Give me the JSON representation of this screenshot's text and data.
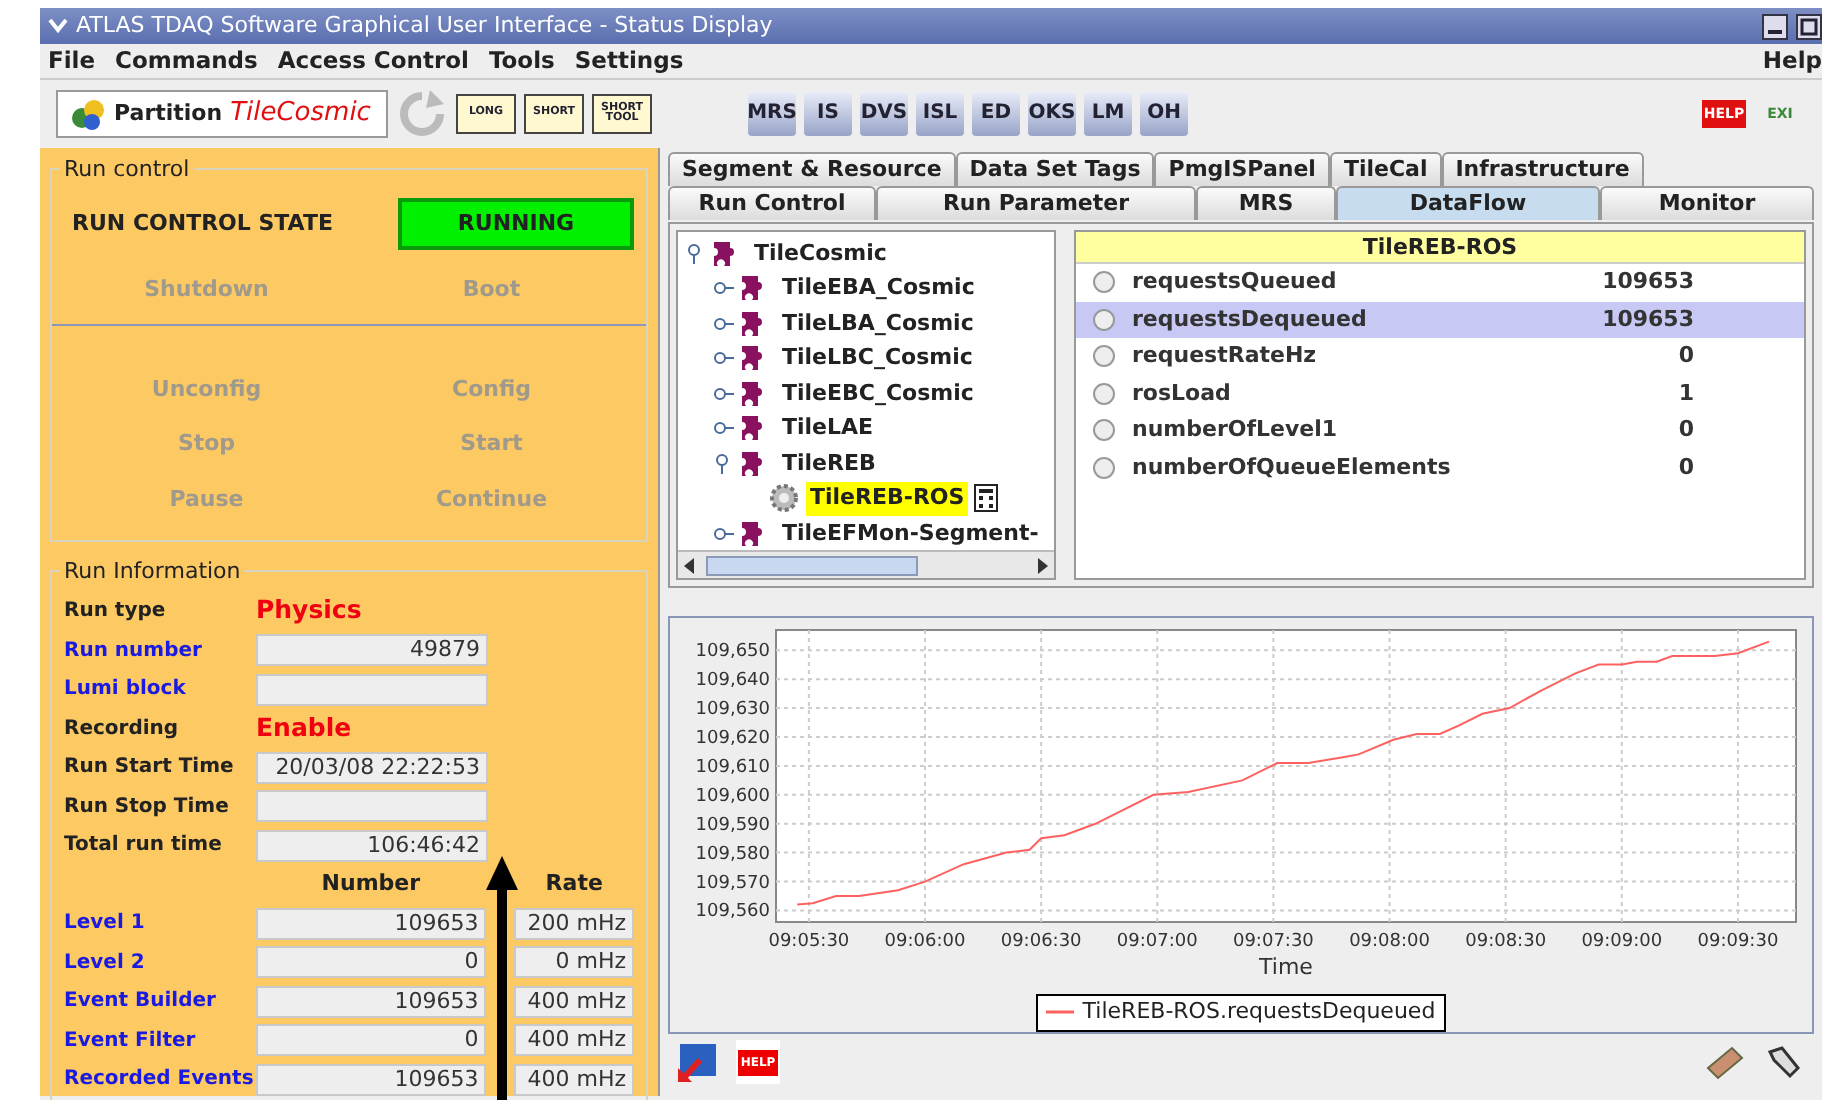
{
  "window": {
    "title": "ATLAS TDAQ Software Graphical User Interface - Status Display"
  },
  "menu": [
    {
      "label": "File"
    },
    {
      "label": "Commands"
    },
    {
      "label": "Access Control"
    },
    {
      "label": "Tools"
    },
    {
      "label": "Settings"
    }
  ],
  "help_menu": "Help",
  "toolbar": {
    "partition_label": "Partition",
    "partition_name": "TileCosmic",
    "tools": [
      {
        "kind": "reload",
        "disabled": true
      },
      {
        "kind": "label",
        "label": "LONG"
      },
      {
        "kind": "label",
        "label": "SHORT"
      },
      {
        "kind": "label",
        "label": "SHORT TOOL"
      },
      {
        "kind": "gap"
      },
      {
        "kind": "label",
        "label": "MRS"
      },
      {
        "kind": "label",
        "label": "IS"
      },
      {
        "kind": "label",
        "label": "DVS"
      },
      {
        "kind": "label",
        "label": "ISL"
      },
      {
        "kind": "label",
        "label": "ED"
      },
      {
        "kind": "label",
        "label": "OKS"
      },
      {
        "kind": "label",
        "label": "LM"
      },
      {
        "kind": "label",
        "label": "OH"
      }
    ],
    "right_tools": [
      {
        "label": "HELP"
      },
      {
        "label": "EXI"
      }
    ]
  },
  "run_control": {
    "title": "Run control",
    "state_label": "RUN CONTROL STATE",
    "state": "RUNNING",
    "upper_commands": [
      {
        "label": "Shutdown",
        "disabled": true
      },
      {
        "label": "Boot",
        "disabled": true
      }
    ],
    "lower_commands": [
      {
        "label": "Unconfig",
        "disabled": true
      },
      {
        "label": "Config",
        "disabled": true
      },
      {
        "label": "Stop",
        "disabled": true
      },
      {
        "label": "Start",
        "disabled": true
      },
      {
        "label": "Pause",
        "disabled": true
      },
      {
        "label": "Continue",
        "disabled": true
      }
    ]
  },
  "run_info": {
    "title": "Run Information",
    "fields": [
      {
        "label": "Run type",
        "linked": false,
        "kind": "text",
        "value": "Physics"
      },
      {
        "label": "Run number",
        "linked": true,
        "kind": "field",
        "value": "49879"
      },
      {
        "label": "Lumi block",
        "linked": true,
        "kind": "field"
      },
      {
        "label": "Recording",
        "linked": false,
        "kind": "text",
        "value": "Enable"
      },
      {
        "label": "Run Start Time",
        "linked": false,
        "kind": "field",
        "value": "20/03/08 22:22:53"
      },
      {
        "label": "Run Stop Time",
        "linked": false,
        "kind": "field"
      },
      {
        "label": "Total run time",
        "linked": false,
        "kind": "field",
        "value": "106:46:42"
      }
    ],
    "counter_headers": [
      "Number",
      "Rate"
    ],
    "counters": [
      {
        "label": "Level 1",
        "number": "109653",
        "rate": "200 mHz"
      },
      {
        "label": "Level 2",
        "number": "0",
        "rate": "0 mHz"
      },
      {
        "label": "Event Builder",
        "number": "109653",
        "rate": "400 mHz"
      },
      {
        "label": "Event Filter",
        "number": "0",
        "rate": "400 mHz"
      },
      {
        "label": "Recorded Events",
        "number": "109653",
        "rate": "400 mHz"
      }
    ]
  },
  "tabs_row_1": [
    {
      "label": "Segment & Resource",
      "selected": false
    },
    {
      "label": "Data Set Tags",
      "selected": false
    },
    {
      "label": "PmgISPanel",
      "selected": false
    },
    {
      "label": "TileCal",
      "selected": false
    },
    {
      "label": "Infrastructure",
      "selected": false
    }
  ],
  "tabs_row_2": [
    {
      "label": "Run Control",
      "selected": false
    },
    {
      "label": "Run Parameter",
      "selected": false
    },
    {
      "label": "MRS",
      "selected": false
    },
    {
      "label": "DataFlow",
      "selected": true
    },
    {
      "label": "Monitor",
      "selected": false
    }
  ],
  "tree": [
    {
      "label": "TileCosmic",
      "kind": "segment",
      "expanded": true,
      "selected": false,
      "children": [
        {
          "label": "TileEBA_Cosmic",
          "kind": "segment",
          "expanded": false,
          "selected": false
        },
        {
          "label": "TileLBA_Cosmic",
          "kind": "segment",
          "expanded": false,
          "selected": false
        },
        {
          "label": "TileLBC_Cosmic",
          "kind": "segment",
          "expanded": false,
          "selected": false
        },
        {
          "label": "TileEBC_Cosmic",
          "kind": "segment",
          "expanded": false,
          "selected": false
        },
        {
          "label": "TileLAE",
          "kind": "segment",
          "expanded": false,
          "selected": false
        },
        {
          "label": "TileREB",
          "kind": "segment",
          "expanded": true,
          "selected": false,
          "children": [
            {
              "label": "TileREB-ROS",
              "kind": "application",
              "selected": true
            }
          ]
        },
        {
          "label": "TileEFMon-Segment-",
          "kind": "segment",
          "expanded": false,
          "selected": false
        }
      ]
    }
  ],
  "table": {
    "title": "TileREB-ROS",
    "rows": [
      {
        "name": "requestsQueued",
        "value": "109653",
        "selected": false
      },
      {
        "name": "requestsDequeued",
        "value": "109653",
        "selected": true
      },
      {
        "name": "requestRateHz",
        "value": "0",
        "selected": false
      },
      {
        "name": "rosLoad",
        "value": "1",
        "selected": false
      },
      {
        "name": "numberOfLevel1",
        "value": "0",
        "selected": false
      },
      {
        "name": "numberOfQueueElements",
        "value": "0",
        "selected": false
      }
    ]
  },
  "chart": {
    "chart_data": {
      "type": "line",
      "xlabel": "Time",
      "grid": true,
      "xlim": [
        32721.5,
        32985
      ],
      "ylim": [
        109556,
        109657
      ],
      "xticks": [
        {
          "value": 32730,
          "label": "09:05:30"
        },
        {
          "value": 32760,
          "label": "09:06:00"
        },
        {
          "value": 32790,
          "label": "09:06:30"
        },
        {
          "value": 32820,
          "label": "09:07:00"
        },
        {
          "value": 32850,
          "label": "09:07:30"
        },
        {
          "value": 32880,
          "label": "09:08:00"
        },
        {
          "value": 32910,
          "label": "09:08:30"
        },
        {
          "value": 32940,
          "label": "09:09:00"
        },
        {
          "value": 32970,
          "label": "09:09:30"
        }
      ],
      "yticks": [
        {
          "value": 109560,
          "label": "109,560"
        },
        {
          "value": 109570,
          "label": "109,570"
        },
        {
          "value": 109580,
          "label": "109,580"
        },
        {
          "value": 109590,
          "label": "109,590"
        },
        {
          "value": 109600,
          "label": "109,600"
        },
        {
          "value": 109610,
          "label": "109,610"
        },
        {
          "value": 109620,
          "label": "109,620"
        },
        {
          "value": 109630,
          "label": "109,630"
        },
        {
          "value": 109640,
          "label": "109,640"
        },
        {
          "value": 109650,
          "label": "109,650"
        }
      ],
      "x": [
        32727,
        32731,
        32737,
        32743,
        32753,
        32760,
        32770,
        32781,
        32787,
        32790,
        32796,
        32804,
        32819,
        32828,
        32842,
        32851,
        32859,
        32868,
        32872,
        32881,
        32887,
        32893,
        32898,
        32904,
        32911,
        32919,
        32928,
        32934,
        32940,
        32944,
        32949,
        32953,
        32964,
        32970,
        32978
      ],
      "series": [
        {
          "name": "TileREB-ROS.requestsDequeued",
          "color": "#ff6060",
          "values": [
            109562,
            109562.5,
            109565,
            109565,
            109567,
            109570,
            109576,
            109580,
            109581,
            109585,
            109586,
            109590,
            109600,
            109601,
            109605,
            109611,
            109611,
            109613,
            109614,
            109619,
            109621,
            109621,
            109624,
            109628,
            109630,
            109636,
            109642,
            109645,
            109645,
            109646,
            109646,
            109648,
            109648,
            109649,
            109653
          ]
        }
      ]
    }
  },
  "bottom_toolbar": {
    "help_label": "HELP"
  }
}
